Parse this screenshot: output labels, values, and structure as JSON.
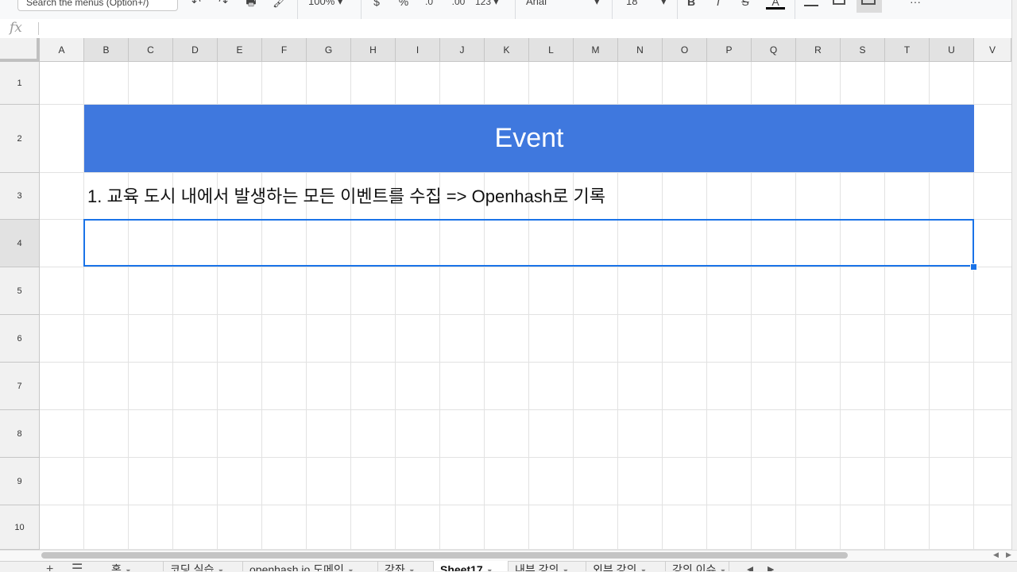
{
  "toolbar": {
    "search_placeholder": "Search the menus (Option+/)",
    "undo_icon": "↶",
    "redo_icon": "↷",
    "print_icon": "🖶",
    "paint_format_icon": "🖌",
    "zoom": "100%",
    "currency": "$",
    "percent": "%",
    "decrease_decimal": ".0",
    "increase_decimal": ".00",
    "more_formats": "123",
    "font": "Arial",
    "font_size": "18",
    "bold": "B",
    "italic": "I",
    "strikethrough": "S",
    "text_color": "A",
    "more": "···"
  },
  "formula_bar": {
    "fx_label": "fx",
    "value": ""
  },
  "columns": [
    "A",
    "B",
    "C",
    "D",
    "E",
    "F",
    "G",
    "H",
    "I",
    "J",
    "K",
    "L",
    "M",
    "N",
    "O",
    "P",
    "Q",
    "R",
    "S",
    "T",
    "U",
    "V"
  ],
  "rows": [
    "1",
    "2",
    "3",
    "4",
    "5",
    "6",
    "7",
    "8",
    "9",
    "10"
  ],
  "cells": {
    "B2": "Event",
    "B3": "1. 교육 도시 내에서 발생하는 모든 이벤트를 수집 => Openhash로 기록"
  },
  "colors": {
    "banner": "#3f78de",
    "selection": "#1a73e8"
  },
  "sheet_tabs": [
    {
      "label": "홈",
      "active": false
    },
    {
      "label": "코딩 실습",
      "active": false
    },
    {
      "label": "openhash.io 도메인",
      "active": false
    },
    {
      "label": "강좌",
      "active": false
    },
    {
      "label": "Sheet17",
      "active": true
    },
    {
      "label": "내부 강의",
      "active": false
    },
    {
      "label": "외부 강의",
      "active": false
    },
    {
      "label": "강의 이슈",
      "active": false
    }
  ]
}
